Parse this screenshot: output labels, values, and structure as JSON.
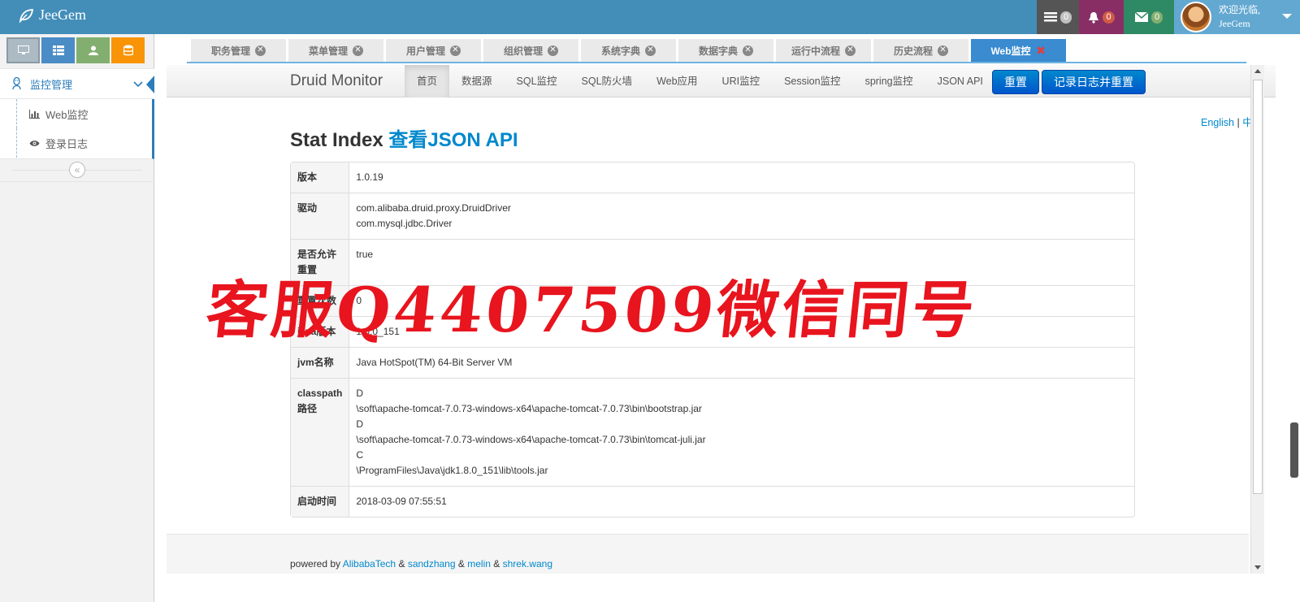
{
  "navbar": {
    "brand": "JeeGem",
    "tasks_count": "0",
    "notifications_count": "0",
    "messages_count": "0",
    "user_greeting": "欢迎光临,",
    "user_name": "JeeGem"
  },
  "sidebar": {
    "menu_title": "监控管理",
    "items": [
      {
        "label": "Web监控",
        "icon": "bar-chart-icon"
      },
      {
        "label": "登录日志",
        "icon": "eye-icon"
      }
    ]
  },
  "tabs": [
    {
      "label": "职务管理"
    },
    {
      "label": "菜单管理"
    },
    {
      "label": "用户管理"
    },
    {
      "label": "组织管理"
    },
    {
      "label": "系统字典"
    },
    {
      "label": "数据字典"
    },
    {
      "label": "运行中流程"
    },
    {
      "label": "历史流程"
    },
    {
      "label": "Web监控",
      "active": true
    }
  ],
  "druid": {
    "brand": "Druid Monitor",
    "menu": [
      "首页",
      "数据源",
      "SQL监控",
      "SQL防火墙",
      "Web应用",
      "URI监控",
      "Session监控",
      "spring监控",
      "JSON API"
    ],
    "btn_reset": "重置",
    "btn_log_reset": "记录日志并重置",
    "lang_en": "English",
    "lang_sep": "|",
    "lang_zh": "中文",
    "title": "Stat Index",
    "title_link": "查看JSON API",
    "rows": [
      {
        "key": "版本",
        "value": "1.0.19"
      },
      {
        "key": "驱动",
        "lines": [
          "com.alibaba.druid.proxy.DruidDriver",
          "com.mysql.jdbc.Driver"
        ]
      },
      {
        "key": "是否允许重置",
        "value": "true"
      },
      {
        "key": "重置次数",
        "value": "0"
      },
      {
        "key": "java版本",
        "value": "1.8.0_151"
      },
      {
        "key": "jvm名称",
        "value": "Java HotSpot(TM) 64-Bit Server VM"
      },
      {
        "key": "classpath路径",
        "lines": [
          "D",
          "\\soft\\apache-tomcat-7.0.73-windows-x64\\apache-tomcat-7.0.73\\bin\\bootstrap.jar",
          "D",
          "\\soft\\apache-tomcat-7.0.73-windows-x64\\apache-tomcat-7.0.73\\bin\\tomcat-juli.jar",
          "C",
          "\\ProgramFiles\\Java\\jdk1.8.0_151\\lib\\tools.jar"
        ]
      },
      {
        "key": "启动时间",
        "value": "2018-03-09 07:55:51"
      }
    ],
    "footer": {
      "prefix": "powered by",
      "links": [
        "AlibabaTech",
        "sandzhang",
        "melin",
        "shrek.wang"
      ],
      "sep": "&"
    }
  },
  "watermark": "客服Q4407509微信同号",
  "colors": {
    "navbar": "#438eb9",
    "accent": "#2b7dbc",
    "tab_active": "#3a8bd0",
    "button": "#0069cc",
    "watermark": "#e8141e"
  }
}
